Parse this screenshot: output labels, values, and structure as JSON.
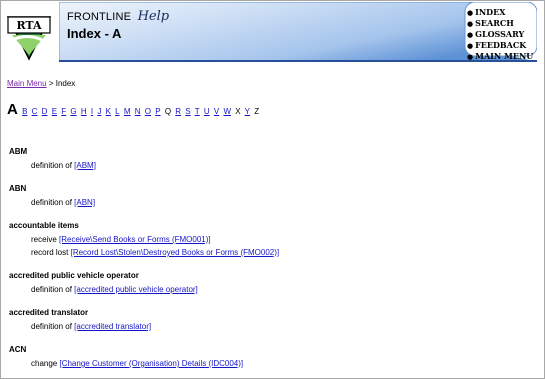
{
  "header": {
    "brand": "FRONTLINE",
    "help": "Help",
    "page_title": "Index - A",
    "logo_text": "RTA",
    "nav": [
      {
        "label": "INDEX"
      },
      {
        "label": "SEARCH"
      },
      {
        "label": "GLOSSARY"
      },
      {
        "label": "FEEDBACK"
      },
      {
        "label": "MAIN MENU"
      }
    ]
  },
  "breadcrumb": {
    "link": "Main Menu",
    "separator": ">",
    "current": "Index"
  },
  "alphabet": {
    "current": "A",
    "letters": [
      {
        "l": "B",
        "link": true
      },
      {
        "l": "C",
        "link": true
      },
      {
        "l": "D",
        "link": true
      },
      {
        "l": "E",
        "link": true
      },
      {
        "l": "F",
        "link": true
      },
      {
        "l": "G",
        "link": true
      },
      {
        "l": "H",
        "link": true
      },
      {
        "l": "I",
        "link": true
      },
      {
        "l": "J",
        "link": true
      },
      {
        "l": "K",
        "link": true
      },
      {
        "l": "L",
        "link": true
      },
      {
        "l": "M",
        "link": true
      },
      {
        "l": "N",
        "link": true
      },
      {
        "l": "O",
        "link": true
      },
      {
        "l": "P",
        "link": true
      },
      {
        "l": "Q",
        "link": false
      },
      {
        "l": "R",
        "link": true
      },
      {
        "l": "S",
        "link": true
      },
      {
        "l": "T",
        "link": true
      },
      {
        "l": "U",
        "link": true
      },
      {
        "l": "V",
        "link": true
      },
      {
        "l": "W",
        "link": true
      },
      {
        "l": "X",
        "link": false
      },
      {
        "l": "Y",
        "link": true
      },
      {
        "l": "Z",
        "link": false
      }
    ]
  },
  "entries": [
    {
      "term": "ABM",
      "subs": [
        {
          "label": "definition of",
          "link": "[ABM]"
        }
      ]
    },
    {
      "term": "ABN",
      "subs": [
        {
          "label": "definition of",
          "link": "[ABN]"
        }
      ]
    },
    {
      "term": "accountable items",
      "subs": [
        {
          "label": "receive",
          "link": "[Receive\\Send Books or Forms (FMO001)]"
        },
        {
          "label": "record lost",
          "link": "[Record Lost\\Stolen\\Destroyed Books or Forms (FMO002)]"
        }
      ]
    },
    {
      "term": "accredited public vehicle operator",
      "subs": [
        {
          "label": "definition of",
          "link": "[accredited public vehicle operator]"
        }
      ]
    },
    {
      "term": "accredited translator",
      "subs": [
        {
          "label": "definition of",
          "link": "[accredited translator]"
        }
      ]
    },
    {
      "term": "ACN",
      "subs": [
        {
          "label": "change",
          "link": "[Change Customer (Organisation) Details (IDC004)]"
        }
      ]
    }
  ],
  "colors": {
    "banner_light": "#e6f0fb",
    "banner_mid": "#a9c8ec",
    "banner_dark": "#4f86cf",
    "link": "#1515c8",
    "visited": "#7b2aa8"
  }
}
